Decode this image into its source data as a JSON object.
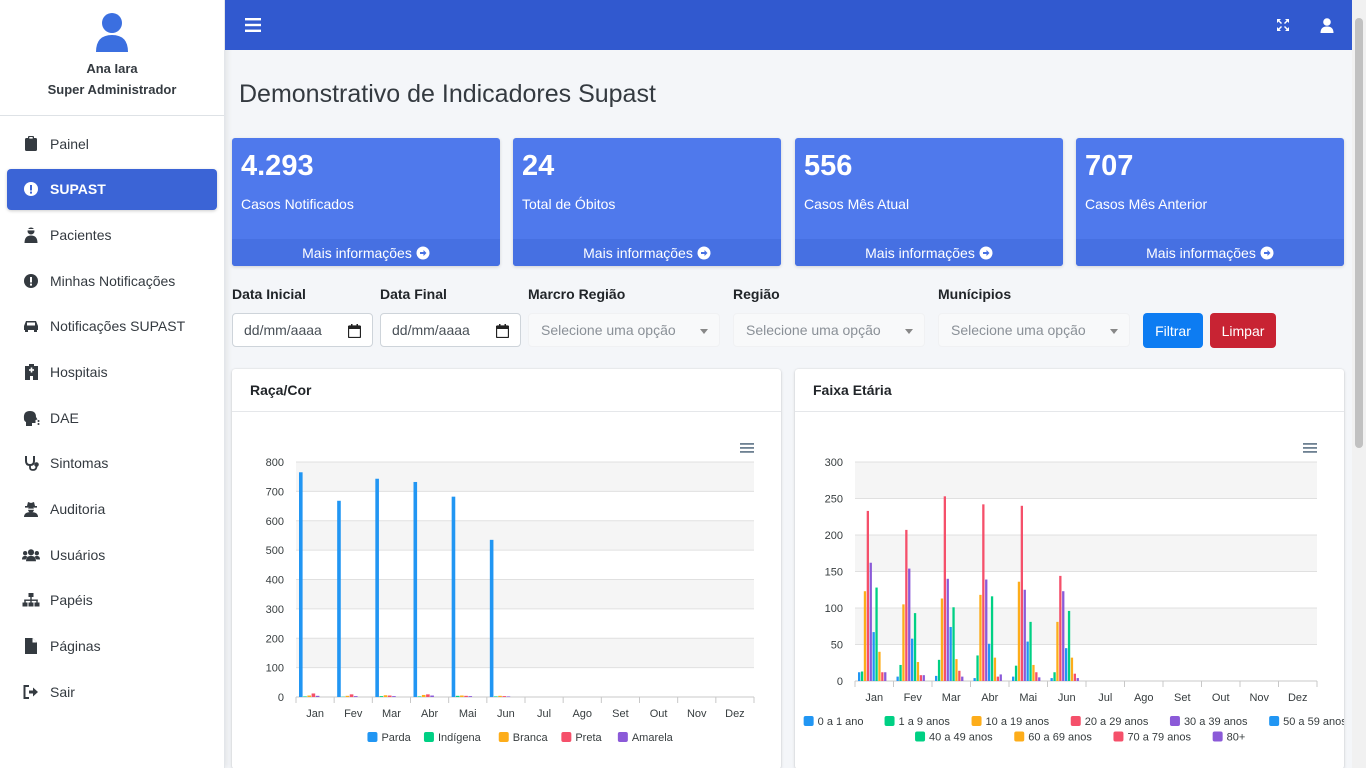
{
  "user": {
    "name": "Ana Iara",
    "role": "Super Administrador"
  },
  "sidebar": {
    "items": [
      {
        "label": "Painel",
        "icon": "clipboard-icon",
        "active": false
      },
      {
        "label": "SUPAST",
        "icon": "exclamation-circle-icon",
        "active": true
      },
      {
        "label": "Pacientes",
        "icon": "user-injured-icon",
        "active": false
      },
      {
        "label": "Minhas Notificações",
        "icon": "exclamation-circle-icon",
        "active": false
      },
      {
        "label": "Notificações SUPAST",
        "icon": "car-icon",
        "active": false
      },
      {
        "label": "Hospitais",
        "icon": "hospital-icon",
        "active": false
      },
      {
        "label": "DAE",
        "icon": "head-icon",
        "active": false
      },
      {
        "label": "Sintomas",
        "icon": "stethoscope-icon",
        "active": false
      },
      {
        "label": "Auditoria",
        "icon": "user-secret-icon",
        "active": false
      },
      {
        "label": "Usuários",
        "icon": "users-icon",
        "active": false
      },
      {
        "label": "Papéis",
        "icon": "sitemap-icon",
        "active": false
      },
      {
        "label": "Páginas",
        "icon": "file-icon",
        "active": false
      },
      {
        "label": "Sair",
        "icon": "sign-out-icon",
        "active": false
      }
    ]
  },
  "page": {
    "title": "Demonstrativo de Indicadores Supast"
  },
  "stats": [
    {
      "value": "4.293",
      "label": "Casos Notificados",
      "more": "Mais informações"
    },
    {
      "value": "24",
      "label": "Total de Óbitos",
      "more": "Mais informações"
    },
    {
      "value": "556",
      "label": "Casos Mês Atual",
      "more": "Mais informações"
    },
    {
      "value": "707",
      "label": "Casos Mês Anterior",
      "more": "Mais informações"
    }
  ],
  "filters": {
    "data_inicial_label": "Data Inicial",
    "data_final_label": "Data Final",
    "date_placeholder": "dd/mm/aaaa",
    "macro_regiao_label": "Marcro Região",
    "regiao_label": "Região",
    "municipios_label": "Munícipios",
    "select_placeholder": "Selecione uma opção",
    "filtrar": "Filtrar",
    "limpar": "Limpar"
  },
  "colors": {
    "primary": "#3159cf",
    "card": "#4f79ec",
    "filtrar": "#0d7cf2",
    "limpar": "#c82333"
  },
  "chart_data": [
    {
      "type": "bar",
      "title": "Raça/Cor",
      "categories": [
        "Jan",
        "Fev",
        "Mar",
        "Abr",
        "Mai",
        "Jun",
        "Jul",
        "Ago",
        "Set",
        "Out",
        "Nov",
        "Dez"
      ],
      "ylim": [
        0,
        800
      ],
      "yticks": [
        0,
        100,
        200,
        300,
        400,
        500,
        600,
        700,
        800
      ],
      "legend": "bottom",
      "grid": true,
      "series": [
        {
          "name": "Parda",
          "color": "#2196f3",
          "values": [
            765,
            668,
            743,
            732,
            682,
            535,
            0,
            0,
            0,
            0,
            0,
            0
          ]
        },
        {
          "name": "Indígena",
          "color": "#00d084",
          "values": [
            2,
            1,
            3,
            2,
            4,
            2,
            0,
            0,
            0,
            0,
            0,
            0
          ]
        },
        {
          "name": "Branca",
          "color": "#fdad1a",
          "values": [
            5,
            4,
            6,
            7,
            5,
            4,
            0,
            0,
            0,
            0,
            0,
            0
          ]
        },
        {
          "name": "Preta",
          "color": "#f5506a",
          "values": [
            12,
            9,
            5,
            9,
            4,
            3,
            0,
            0,
            0,
            0,
            0,
            0
          ]
        },
        {
          "name": "Amarela",
          "color": "#8b5ad8",
          "values": [
            4,
            3,
            3,
            5,
            3,
            2,
            0,
            0,
            0,
            0,
            0,
            0
          ]
        }
      ]
    },
    {
      "type": "bar",
      "title": "Faixa Etária",
      "categories": [
        "Jan",
        "Fev",
        "Mar",
        "Abr",
        "Mai",
        "Jun",
        "Jul",
        "Ago",
        "Set",
        "Out",
        "Nov",
        "Dez"
      ],
      "ylim": [
        0,
        300
      ],
      "yticks": [
        0,
        50,
        100,
        150,
        200,
        250,
        300
      ],
      "legend": "bottom",
      "grid": true,
      "series": [
        {
          "name": "0 a 1 ano",
          "color": "#2196f3",
          "values": [
            12,
            6,
            7,
            4,
            6,
            4,
            0,
            0,
            0,
            0,
            0,
            0
          ]
        },
        {
          "name": "1 a 9 anos",
          "color": "#00d084",
          "values": [
            13,
            22,
            29,
            35,
            21,
            12,
            0,
            0,
            0,
            0,
            0,
            0
          ]
        },
        {
          "name": "10 a 19 anos",
          "color": "#fdad1a",
          "values": [
            123,
            105,
            113,
            118,
            136,
            81,
            0,
            0,
            0,
            0,
            0,
            0
          ]
        },
        {
          "name": "20 a 29 anos",
          "color": "#f5506a",
          "values": [
            233,
            207,
            253,
            242,
            240,
            144,
            0,
            0,
            0,
            0,
            0,
            0
          ]
        },
        {
          "name": "30 a 39 anos",
          "color": "#8b5ad8",
          "values": [
            162,
            154,
            140,
            139,
            125,
            123,
            0,
            0,
            0,
            0,
            0,
            0
          ]
        },
        {
          "name": "50 a 59 anos",
          "color": "#2196f3",
          "values": [
            67,
            58,
            74,
            51,
            54,
            45,
            0,
            0,
            0,
            0,
            0,
            0
          ]
        },
        {
          "name": "40 a 49 anos",
          "color": "#00d084",
          "values": [
            128,
            93,
            101,
            116,
            81,
            96,
            0,
            0,
            0,
            0,
            0,
            0
          ]
        },
        {
          "name": "60 a 69 anos",
          "color": "#fdad1a",
          "values": [
            40,
            26,
            30,
            32,
            22,
            32,
            0,
            0,
            0,
            0,
            0,
            0
          ]
        },
        {
          "name": "70 a 79 anos",
          "color": "#f5506a",
          "values": [
            12,
            8,
            14,
            6,
            12,
            10,
            0,
            0,
            0,
            0,
            0,
            0
          ]
        },
        {
          "name": "80+",
          "color": "#8b5ad8",
          "values": [
            12,
            8,
            6,
            9,
            5,
            4,
            0,
            0,
            0,
            0,
            0,
            0
          ]
        }
      ]
    }
  ]
}
